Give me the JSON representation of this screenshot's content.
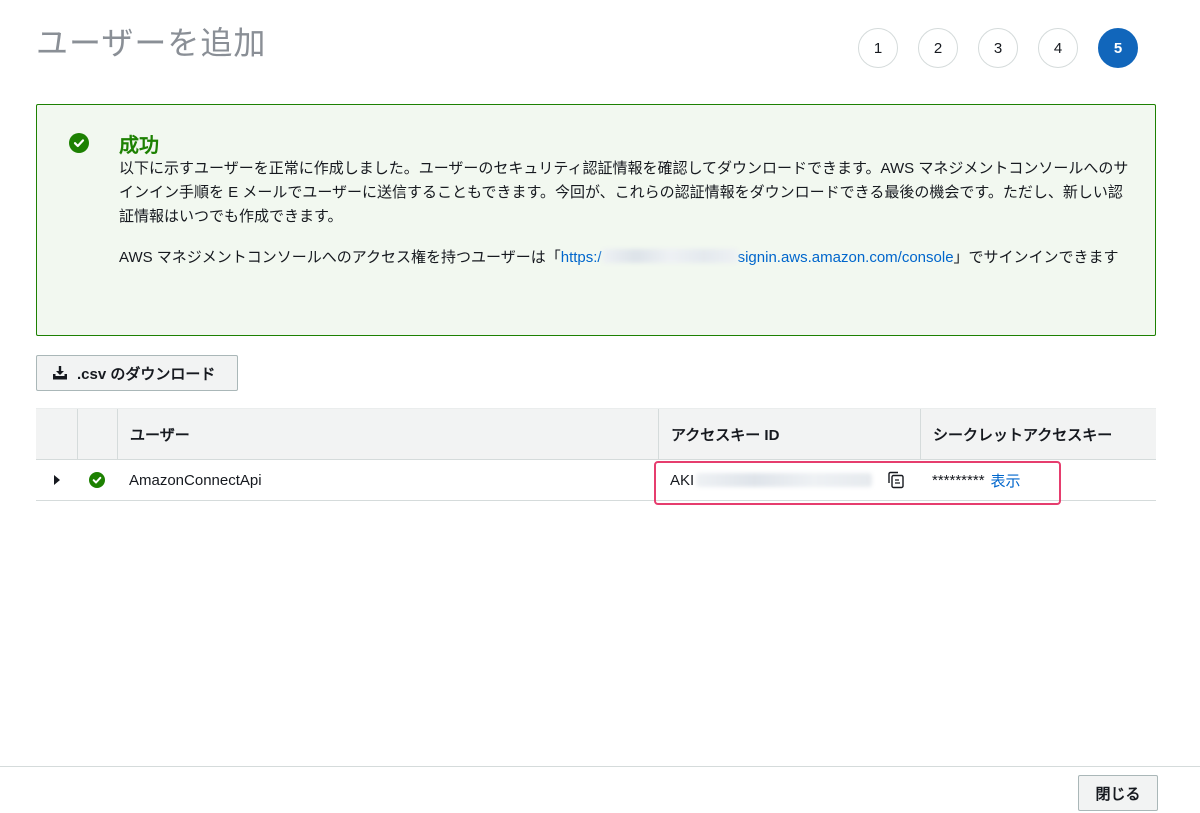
{
  "header": {
    "title": "ユーザーを追加",
    "steps": [
      "1",
      "2",
      "3",
      "4",
      "5"
    ],
    "active_step": "5"
  },
  "alert": {
    "title": "成功",
    "body_line": "以下に示すユーザーを正常に作成しました。ユーザーのセキュリティ認証情報を確認してダウンロードできます。AWS マネジメントコンソールへのサインイン手順を E メールでユーザーに送信することもできます。今回が、これらの認証情報をダウンロードできる最後の機会です。ただし、新しい認証情報はいつでも作成できます。",
    "console_prefix": "AWS マネジメントコンソールへのアクセス権を持つユーザーは「",
    "console_link_start": "https:/",
    "console_link_end": "signin.aws.amazon.com/console",
    "console_suffix": "」でサインインできます",
    "colors": {
      "border": "#1d8102",
      "background": "#f2f8f0",
      "title": "#1d8102"
    }
  },
  "actions": {
    "csv_download_label": ".csv のダウンロード",
    "close_label": "閉じる"
  },
  "table": {
    "columns": [
      "",
      "",
      "ユーザー",
      "アクセスキー ID",
      "シークレットアクセスキー"
    ],
    "rows": [
      {
        "user": "AmazonConnectApi",
        "access_key_prefix": "AKI",
        "secret_mask": "*********",
        "show_label": "表示"
      }
    ]
  },
  "icons": {
    "success": "check-circle-icon",
    "download": "download-icon",
    "copy": "copy-icon",
    "expand": "caret-right-icon"
  },
  "colors": {
    "accent": "#1166bb",
    "link": "#0066cc",
    "highlight": "#e63d6e"
  }
}
